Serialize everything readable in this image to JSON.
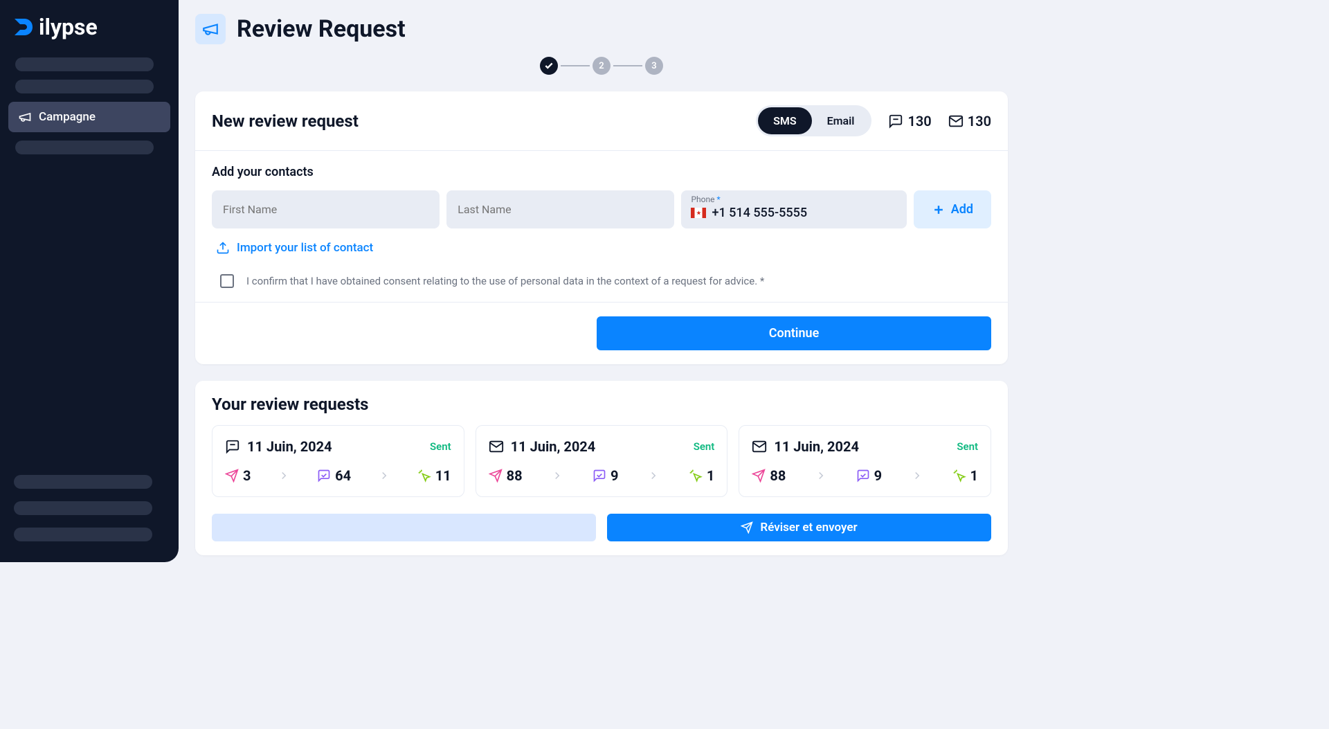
{
  "logo": {
    "text": "ilypse"
  },
  "sidebar": {
    "active_label": "Campagne"
  },
  "page": {
    "title": "Review Request"
  },
  "stepper": {
    "step2": "2",
    "step3": "3"
  },
  "new_request": {
    "title": "New review request",
    "toggle": {
      "sms": "SMS",
      "email": "Email"
    },
    "stats": {
      "sms_count": "130",
      "email_count": "130"
    },
    "section_label": "Add your contacts",
    "first_name_placeholder": "First Name",
    "last_name_placeholder": "Last Name",
    "phone_label": "Phone",
    "phone_value": "+1  514 555-5555",
    "add_label": "Add",
    "import_label": "Import your list of contact",
    "consent_text": "I confirm that I have obtained consent relating to the use of personal data in the context of a request for advice. *",
    "continue_label": "Continue"
  },
  "list": {
    "title": "Your review requests",
    "items": [
      {
        "type": "sms",
        "date": "11 Juin, 2024",
        "status": "Sent",
        "sent": "3",
        "delivered": "64",
        "clicked": "11"
      },
      {
        "type": "email",
        "date": "11 Juin, 2024",
        "status": "Sent",
        "sent": "88",
        "delivered": "9",
        "clicked": "1"
      },
      {
        "type": "email",
        "date": "11 Juin, 2024",
        "status": "Sent",
        "sent": "88",
        "delivered": "9",
        "clicked": "1"
      }
    ]
  },
  "bottom": {
    "review_send": "Réviser et envoyer"
  }
}
